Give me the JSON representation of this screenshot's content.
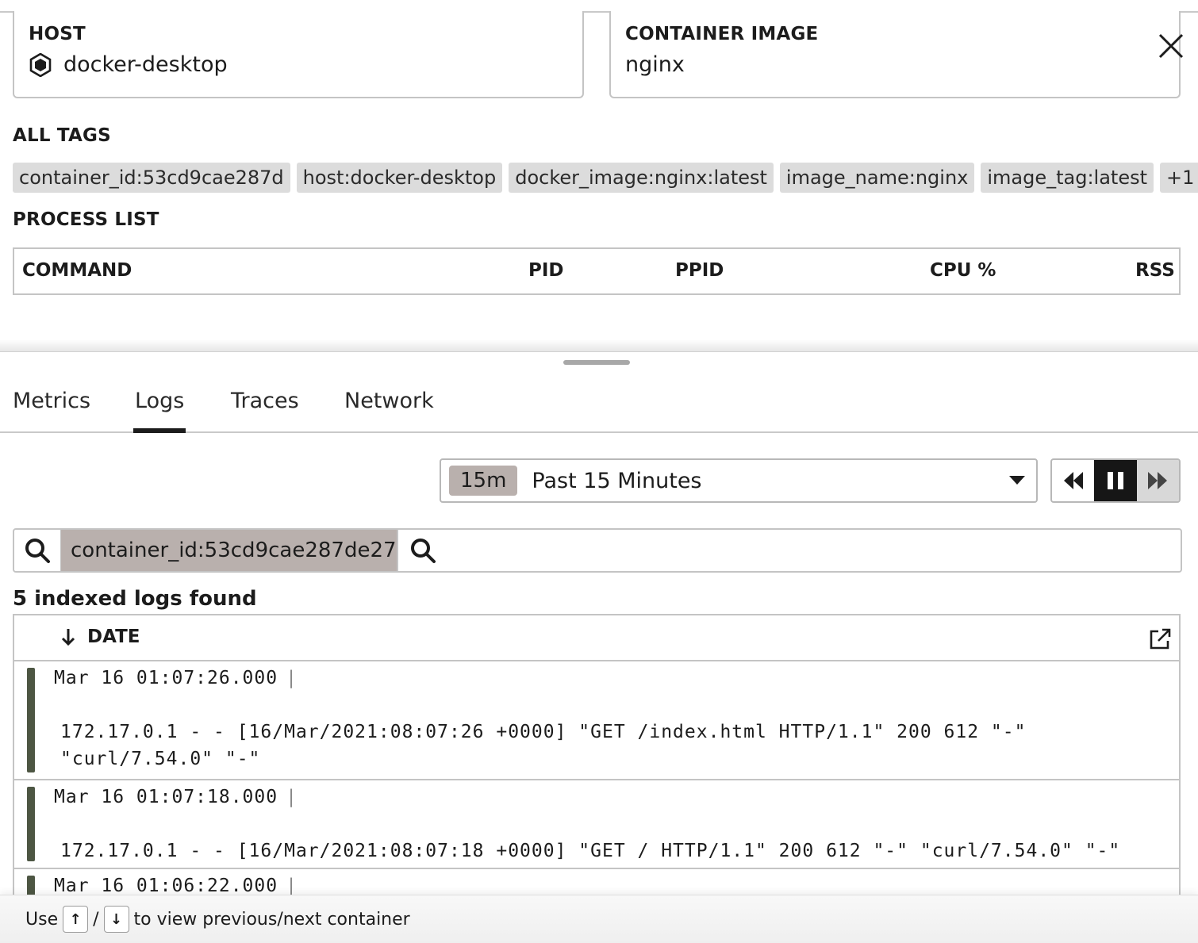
{
  "header": {
    "host_label": "HOST",
    "host_value": "docker-desktop",
    "host_icon": "hexagon-host-icon",
    "image_label": "CONTAINER IMAGE",
    "image_value": "nginx",
    "close_icon": "close-icon"
  },
  "tags": {
    "title": "ALL TAGS",
    "items": [
      "container_id:53cd9cae287d",
      "host:docker-desktop",
      "docker_image:nginx:latest",
      "image_name:nginx",
      "image_tag:latest",
      "+1"
    ]
  },
  "process_list": {
    "title": "PROCESS LIST",
    "columns": [
      "COMMAND",
      "PID",
      "PPID",
      "CPU %",
      "RSS M"
    ]
  },
  "tabs": {
    "items": [
      "Metrics",
      "Logs",
      "Traces",
      "Network"
    ],
    "active": "Logs"
  },
  "time_range": {
    "chip": "15m",
    "label": "Past 15 Minutes"
  },
  "playback": {
    "icons": [
      "rewind-icon",
      "pause-icon",
      "fast-forward-icon"
    ]
  },
  "search": {
    "filter_chip": "container_id:53cd9cae287de27...",
    "placeholder": "",
    "icon": "search-icon"
  },
  "logs": {
    "found_text": "5 indexed logs found",
    "date_column": "DATE",
    "sort_icon": "arrow-down-icon",
    "export_icon": "external-link-icon",
    "status_color": "#4d5643",
    "rows": [
      {
        "date": "Mar 16 01:07:26.000",
        "message": "172.17.0.1 - - [16/Mar/2021:08:07:26 +0000] \"GET /index.html HTTP/1.1\" 200 612 \"-\" \"curl/7.54.0\" \"-\""
      },
      {
        "date": "Mar 16 01:07:18.000",
        "message": "172.17.0.1 - - [16/Mar/2021:08:07:18 +0000] \"GET / HTTP/1.1\" 200 612 \"-\" \"curl/7.54.0\" \"-\""
      },
      {
        "date": "Mar 16 01:06:22.000",
        "message": ""
      }
    ]
  },
  "hint": {
    "prefix": "Use",
    "key_up": "↑",
    "slash": "/",
    "key_down": "↓",
    "suffix": "to view previous/next container"
  }
}
